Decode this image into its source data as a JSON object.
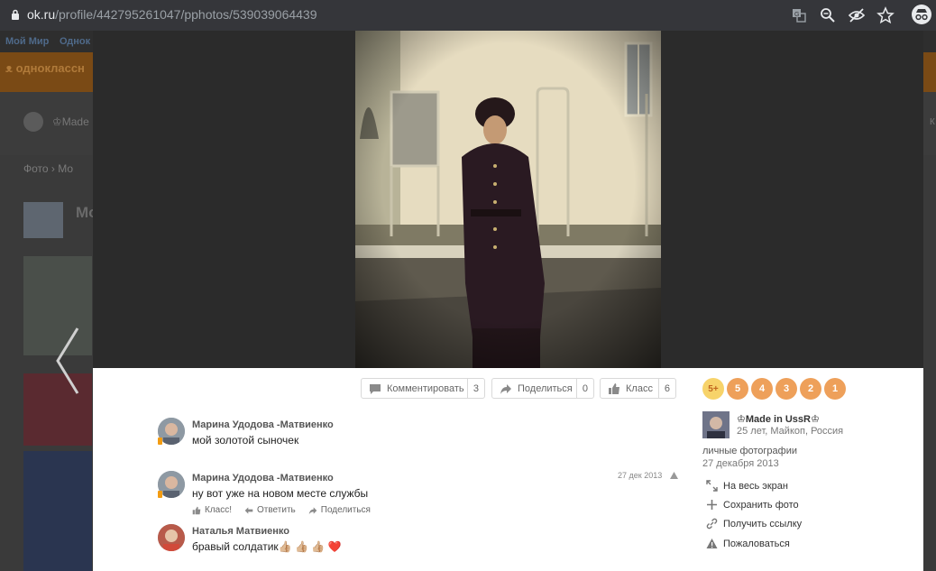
{
  "browser": {
    "url_host": "ok.ru",
    "url_path": "/profile/442795261047/pphotos/539039064439"
  },
  "background": {
    "nav_items": [
      "Мой Мир",
      "Однок"
    ],
    "logo_text": "одноклассн",
    "profile_name": "♔Made",
    "breadcrumb": "Фото  ›  Мо",
    "album_title": "Мо",
    "right_hint": "К"
  },
  "actions": {
    "comment_label": "Комментировать",
    "comment_count": "3",
    "share_label": "Поделиться",
    "share_count": "0",
    "like_label": "Класс",
    "like_count": "6"
  },
  "comments": [
    {
      "author": "Марина Удодова -Матвиенко",
      "text": "мой золотой сыночек"
    },
    {
      "author": "Марина Удодова -Матвиенко",
      "text": "ну вот уже на новом месте службы",
      "date": "27 дек 2013",
      "actions": [
        "Класс!",
        "Ответить",
        "Поделиться"
      ]
    },
    {
      "author": "Наталья Матвиенко",
      "text": "бравый солдатик👍🏼 👍🏼 👍🏼 ❤️"
    }
  ],
  "rating": [
    "5+",
    "5",
    "4",
    "3",
    "2",
    "1"
  ],
  "owner": {
    "name": "♔Made in UssR♔",
    "meta": "25 лет, Майкоп, Россия",
    "album": "личные фотографии",
    "date": "27 декабря 2013"
  },
  "side_links": [
    {
      "label": "На весь экран",
      "icon": "fullscreen-icon"
    },
    {
      "label": "Сохранить фото",
      "icon": "plus-icon"
    },
    {
      "label": "Получить ссылку",
      "icon": "link-icon"
    },
    {
      "label": "Пожаловаться",
      "icon": "warning-icon"
    }
  ],
  "colors": {
    "rating_orange": "#eea05a",
    "rating_top": "#f7d36a",
    "online_badge": "#f39c12"
  }
}
